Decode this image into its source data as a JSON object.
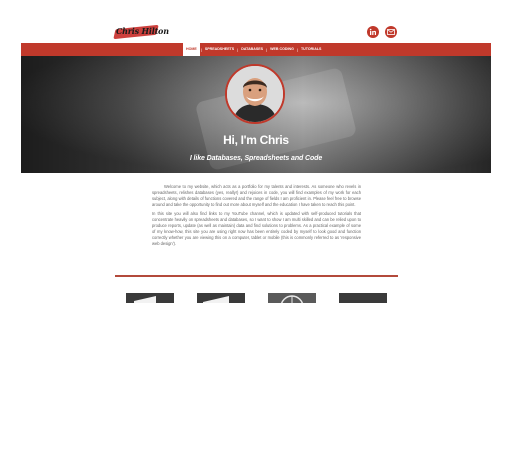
{
  "header": {
    "logo_text": "Chris Hilton",
    "social": [
      {
        "icon": "linkedin-icon",
        "color": "#c0392b"
      },
      {
        "icon": "mail-icon",
        "color": "#c0392b"
      }
    ]
  },
  "nav": {
    "items": [
      {
        "label": "Home",
        "active": true
      },
      {
        "label": "Spreadsheets"
      },
      {
        "label": "Databases"
      },
      {
        "label": "Web Coding"
      },
      {
        "label": "Tutorials"
      }
    ],
    "separator": "|"
  },
  "hero": {
    "title": "Hi, I'm Chris",
    "subtitle": "I like Databases, Spreadsheets and Code"
  },
  "intro": {
    "p1": "Welcome to my website, which acts as a portfolio for my talents and interests. As someone who revels in spreadsheets, relishes databases (yes, really!) and rejoices in code, you will find examples of my work for each subject, along with details of functions covered and the range of fields I am proficient in. Please feel free to browse around and take the opportunity to find out more about myself and the education I have taken to reach this point.",
    "p2": "In this site you will also find links to my YouTube channel, which is updated with self-produced tutorials that concentrate heavily on spreadsheets and databases, so I want to show I am multi skilled and can be relied upon to produce reports, update (as well as maintain) data and find solutions to problems. As a practical example of some of my know-how, this site you are using right now has been entirely coded by myself to look good and function correctly whether you are viewing this on a computer, tablet or mobile (this is commonly referred to as 'responsive web design')."
  },
  "colors": {
    "accent": "#c0392b",
    "divider": "#b34a3b",
    "text": "#666666"
  },
  "tiles": [
    {
      "icon": "spreadsheet-tile"
    },
    {
      "icon": "database-tile"
    },
    {
      "icon": "web-tile"
    },
    {
      "icon": "tutorial-tile"
    }
  ]
}
